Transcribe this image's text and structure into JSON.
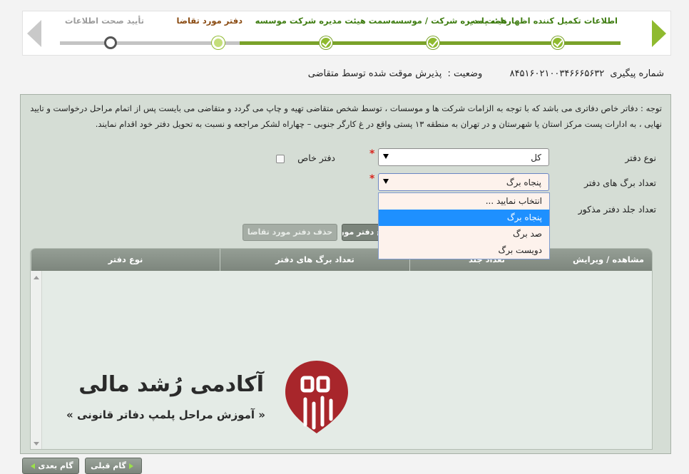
{
  "wizard": {
    "steps": [
      {
        "label": "اطلاعات تکمیل کننده اظهارنامه پلمپ",
        "state": "done"
      },
      {
        "label": "هیئت مدیره شرکت / موسسه",
        "state": "done"
      },
      {
        "label": "سمت هیئت مدیره شرکت موسسه",
        "state": "done"
      },
      {
        "label": "دفتر مورد تقاضا",
        "state": "current"
      },
      {
        "label": "تأیید صحت اطلاعات",
        "state": "todo"
      }
    ]
  },
  "tracking": {
    "label": "شماره پیگیری",
    "number": "۸۴۵۱۶۰۲۱۰۰۳۴۶۶۶۵۶۳۲",
    "status_label": "وضعیت :",
    "status_value": "پذیرش موقت شده توسط متقاضی"
  },
  "notice": "توجه : دفاتر خاص دفاتری می باشد که با توجه به الزامات شرکت ها و موسسات ، توسط شخص متقاضی تهیه و چاپ می گردد و متقاضی می بایست پس از اتمام مراحل درخواست و تایید نهایی ، به ادارات پست مرکز استان یا شهرستان و در تهران به منطقه ۱۳ پستی واقع در غ کارگر جنوبی – چهاراه لشکر مراجعه و نسبت به تحویل دفتر خود اقدام نمایند.",
  "form": {
    "book_type_label": "نوع دفتر",
    "book_type_value": "کل",
    "special_book_label": "دفتر خاص",
    "page_count_label": "تعداد برگ های دفتر",
    "page_count_value": "پنجاه برگ",
    "volume_count_label": "تعداد جلد دفتر مذکور",
    "required_mark": "*"
  },
  "dropdown": {
    "options": [
      "انتخاب نمایید ...",
      "پنجاه برگ",
      "صد برگ",
      "دویست برگ"
    ],
    "selected_index": 1
  },
  "buttons": {
    "add": "درج دفتر مورد تقاضا",
    "delete": "حذف دفتر مورد تقاضا"
  },
  "table": {
    "headers": [
      "نوع دفتر",
      "تعداد برگ های دفتر",
      "تعداد جلد",
      "مشاهده / ویرایش"
    ]
  },
  "watermark": {
    "title": "آکادمی رُشد مالی",
    "subtitle": "« آموزش مراحل پلمپ دفاتر قانونی »"
  },
  "nav": {
    "prev": "گام قبلی",
    "next": "گام بعدی"
  },
  "colors": {
    "accent_green": "#7aa22a",
    "done_label": "#3f7d12",
    "current_label": "#8a4b12",
    "brand_red": "#a8262b"
  }
}
